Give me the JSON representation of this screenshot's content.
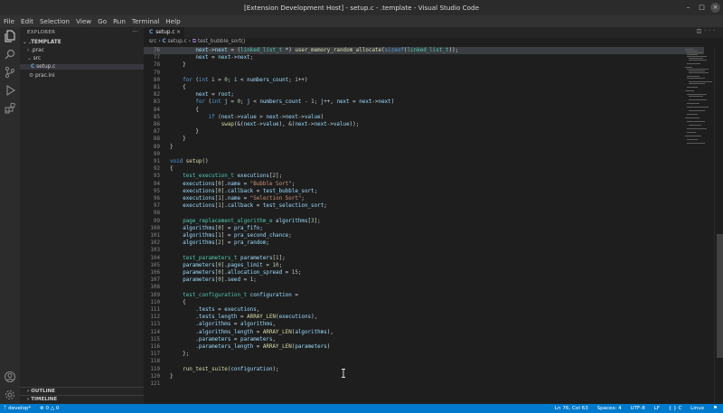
{
  "window": {
    "title": "[Extension Development Host] - setup.c - .template - Visual Studio Code"
  },
  "menu": [
    "File",
    "Edit",
    "Selection",
    "View",
    "Go",
    "Run",
    "Terminal",
    "Help"
  ],
  "sidebar": {
    "title": "EXPLORER",
    "root": ".TEMPLATE",
    "items": [
      ".prac",
      "src",
      "setup.c",
      "prac.ini"
    ],
    "outline": "OUTLINE",
    "timeline": "TIMELINE"
  },
  "tab": {
    "label": "setup.c",
    "lang": "C"
  },
  "breadcrumb": {
    "folder": "src",
    "file": "setup.c",
    "symbol": "test_bubble_sort()"
  },
  "code_lines": [
    {
      "n": "76",
      "t": "        next->next = (linked_list_t *) user_memory_random_allocate(sizeof(linked_list_t));"
    },
    {
      "n": "77",
      "t": "        next = next->next;"
    },
    {
      "n": "78",
      "t": "    }"
    },
    {
      "n": "79",
      "t": ""
    },
    {
      "n": "80",
      "t": "    for (int i = 0; i < numbers_count; i++)"
    },
    {
      "n": "81",
      "t": "    {"
    },
    {
      "n": "82",
      "t": "        next = root;"
    },
    {
      "n": "83",
      "t": "        for (int j = 0; j < numbers_count - 1; j++, next = next->next)"
    },
    {
      "n": "84",
      "t": "        {"
    },
    {
      "n": "85",
      "t": "            if (next->value > next->next->value)"
    },
    {
      "n": "86",
      "t": "                swap(&(next->value), &(next->next->value));"
    },
    {
      "n": "87",
      "t": "        }"
    },
    {
      "n": "88",
      "t": "    }"
    },
    {
      "n": "89",
      "t": "}"
    },
    {
      "n": "90",
      "t": ""
    },
    {
      "n": "91",
      "t": "void setup()"
    },
    {
      "n": "92",
      "t": "{"
    },
    {
      "n": "93",
      "t": "    test_execution_t executions[2];"
    },
    {
      "n": "94",
      "t": "    executions[0].name = \"Bubble Sort\";"
    },
    {
      "n": "95",
      "t": "    executions[0].callback = test_bubble_sort;"
    },
    {
      "n": "96",
      "t": "    executions[1].name = \"Selection Sort\";"
    },
    {
      "n": "97",
      "t": "    executions[1].callback = test_selection_sort;"
    },
    {
      "n": "98",
      "t": ""
    },
    {
      "n": "99",
      "t": "    page_replacement_algorithm_e algorithms[3];"
    },
    {
      "n": "100",
      "t": "    algorithms[0] = pra_fifo;"
    },
    {
      "n": "101",
      "t": "    algorithms[1] = pra_second_chance;"
    },
    {
      "n": "102",
      "t": "    algorithms[2] = pra_random;"
    },
    {
      "n": "103",
      "t": ""
    },
    {
      "n": "104",
      "t": "    test_parameters_t parameters[1];"
    },
    {
      "n": "105",
      "t": "    parameters[0].pages_limit = 10;"
    },
    {
      "n": "106",
      "t": "    parameters[0].allocation_spread = 15;"
    },
    {
      "n": "107",
      "t": "    parameters[0].seed = 1;"
    },
    {
      "n": "108",
      "t": ""
    },
    {
      "n": "109",
      "t": "    test_configuration_t configuration ="
    },
    {
      "n": "110",
      "t": "    {"
    },
    {
      "n": "111",
      "t": "        .tests = executions,"
    },
    {
      "n": "112",
      "t": "        .tests_length = ARRAY_LEN(executions),"
    },
    {
      "n": "113",
      "t": "        .algorithms = algorithms,"
    },
    {
      "n": "114",
      "t": "        .algorithms_length = ARRAY_LEN(algorithms),"
    },
    {
      "n": "115",
      "t": "        .parameters = parameters,"
    },
    {
      "n": "116",
      "t": "        .parameters_length = ARRAY_LEN(parameters)"
    },
    {
      "n": "117",
      "t": "    };"
    },
    {
      "n": "118",
      "t": ""
    },
    {
      "n": "119",
      "t": "    run_test_suite(configuration);"
    },
    {
      "n": "120",
      "t": "}"
    },
    {
      "n": "121",
      "t": ""
    }
  ],
  "status": {
    "branch": "develop*",
    "errors": "0",
    "warnings": "0",
    "position": "Ln 76, Col 63",
    "spaces": "Spaces: 4",
    "encoding": "UTF-8",
    "eol": "LF",
    "language": "C",
    "platform": "Linux"
  },
  "colors": {
    "statusbar": "#007acc",
    "editor_bg": "#1e1e1e",
    "sidebar_bg": "#252526",
    "activitybar_bg": "#2c2c2c"
  }
}
